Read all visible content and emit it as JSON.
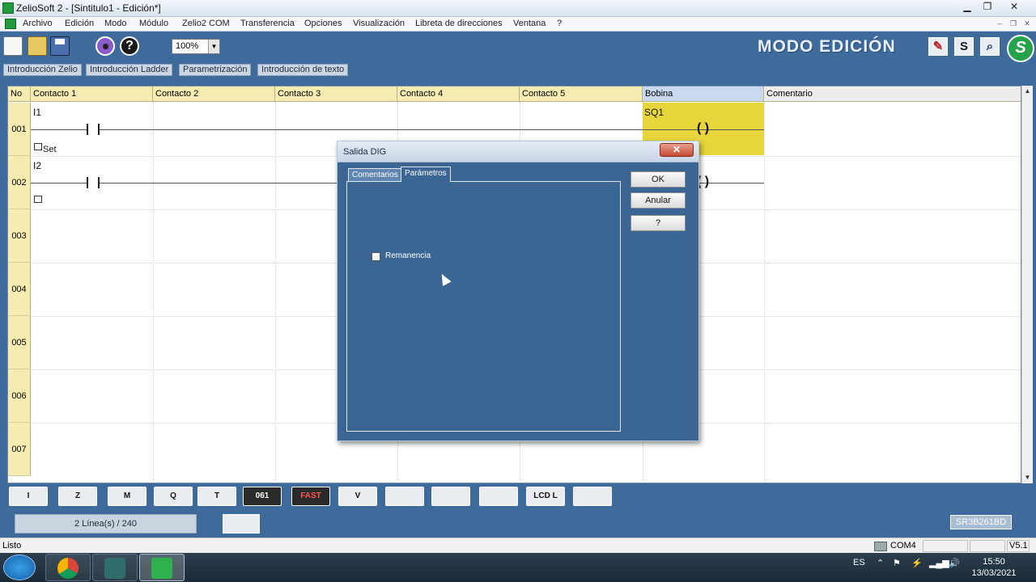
{
  "window": {
    "title": "ZelioSoft 2 - [Sintitulo1 - Edición*]"
  },
  "menu": [
    "Archivo",
    "Edición",
    "Modo",
    "Módulo",
    "Zelio2 COM",
    "Transferencia",
    "Opciones",
    "Visualización",
    "Libreta de direcciones",
    "Ventana",
    "?"
  ],
  "toolbar": {
    "zoom": "100%",
    "mode": "MODO EDICIÓN",
    "mode_buttons": [
      "edit-mode-icon",
      "S",
      "search-icon"
    ]
  },
  "tabs": [
    "Introducción Zelio",
    "Introducción Ladder",
    "Parametrización",
    "Introducción de texto"
  ],
  "grid": {
    "headers": [
      "No",
      "Contacto 1",
      "Contacto 2",
      "Contacto 3",
      "Contacto 4",
      "Contacto 5",
      "Bobina",
      "Comentario"
    ],
    "rows": [
      "001",
      "002",
      "003",
      "004",
      "005",
      "006",
      "007"
    ],
    "row1": {
      "contact": "I1",
      "coil": "SQ1",
      "note": "Set"
    },
    "row2": {
      "contact": "I2"
    }
  },
  "palette": [
    "I",
    "Z",
    "M",
    "Q",
    "T",
    "061",
    "FAST",
    "V",
    "",
    "",
    "",
    "LCD L",
    ""
  ],
  "status": {
    "lines": "2 Línea(s) / 240",
    "model": "SR3B261BD",
    "ready": "Listo",
    "port": "COM4",
    "version": "V5.1"
  },
  "taskbar": {
    "lang": "ES",
    "time": "15:50",
    "date": "13/03/2021"
  },
  "dialog": {
    "title": "Salida DIG",
    "close": "✕",
    "tabs": [
      "Comentarios",
      "Parámetros"
    ],
    "checkbox": "Remanencia",
    "buttons": {
      "ok": "OK",
      "cancel": "Anular",
      "help": "?"
    }
  }
}
